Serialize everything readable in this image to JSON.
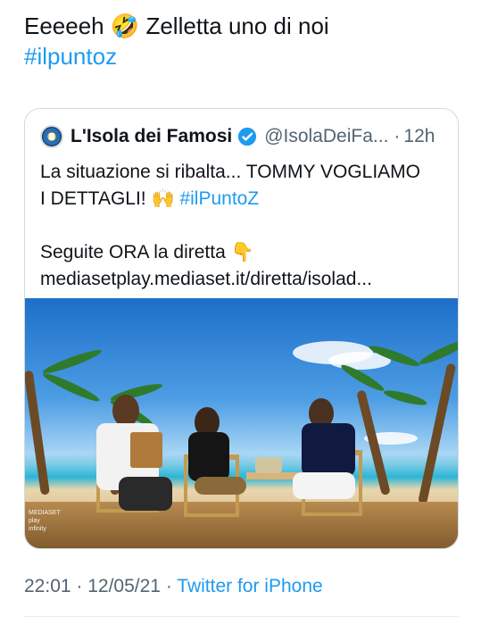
{
  "tweet": {
    "text_line1": "Eeeeeh 🤣 Zelletta uno di noi",
    "hashtag": "#ilpuntoz"
  },
  "quote": {
    "name": "L'Isola dei Famosi",
    "handle": "@IsolaDeiFa...",
    "dot": "·",
    "time": "12h",
    "line1": "La situazione si ribalta... TOMMY VOGLIAMO",
    "line2_text": "I DETTAGLI! 🙌 ",
    "line2_hashtag": "#ilPuntoZ",
    "line3": "Seguite ORA la diretta 👇",
    "line4": "mediasetplay.mediaset.it/diretta/isolad...",
    "media_watermark_line1": "MEDIASET",
    "media_watermark_line2": "play",
    "media_watermark_line3": "infinity"
  },
  "footer": {
    "time": "22:01",
    "sep1": " · ",
    "date": "12/05/21",
    "sep2": " · ",
    "source": "Twitter for iPhone"
  },
  "colors": {
    "link": "#1d9bf0",
    "secondary_text": "#536471",
    "border": "#cfd9de",
    "verified_badge": "#1d9bf0"
  },
  "icons": {
    "verified": "verified-badge-icon",
    "avatar": "account-avatar"
  }
}
